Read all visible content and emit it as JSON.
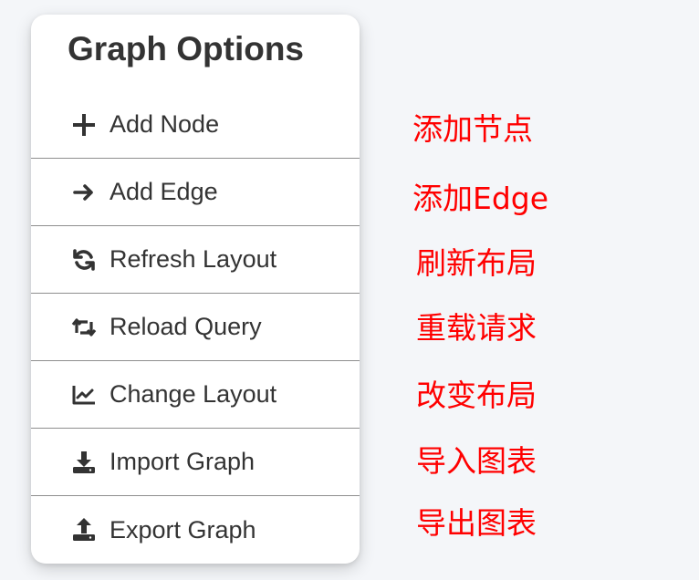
{
  "menu": {
    "title": "Graph Options",
    "items": [
      {
        "label": "Add Node",
        "icon": "plus-icon",
        "annotation": "添加节点"
      },
      {
        "label": "Add Edge",
        "icon": "arrow-right-icon",
        "annotation": "添加Edge"
      },
      {
        "label": "Refresh Layout",
        "icon": "refresh-icon",
        "annotation": "刷新布局"
      },
      {
        "label": "Reload Query",
        "icon": "retweet-icon",
        "annotation": "重载请求"
      },
      {
        "label": "Change Layout",
        "icon": "line-chart-icon",
        "annotation": "改变布局"
      },
      {
        "label": "Import Graph",
        "icon": "download-icon",
        "annotation": "导入图表"
      },
      {
        "label": "Export Graph",
        "icon": "upload-icon",
        "annotation": "导出图表"
      }
    ]
  },
  "colors": {
    "annotation": "#ff0000",
    "text": "#333333",
    "divider": "#8e8e8e",
    "background": "#f4f6f9"
  }
}
